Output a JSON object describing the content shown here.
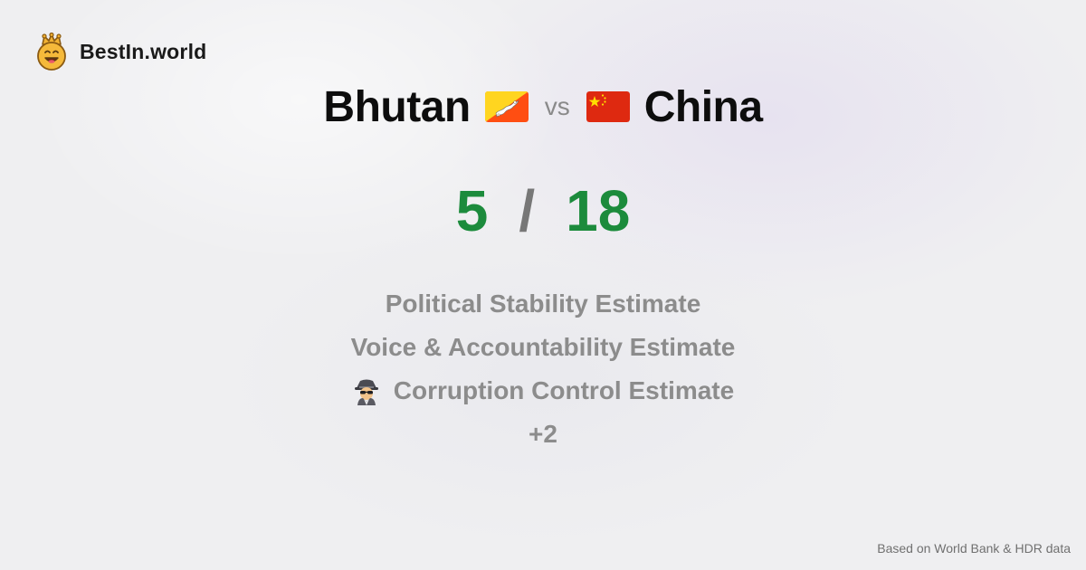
{
  "brand": {
    "logo_icon": "crown-smiley-icon",
    "name": "BestIn.world"
  },
  "comparison": {
    "left_country": "Bhutan",
    "left_flag_icon": "bhutan-flag-icon",
    "vs_label": "vs",
    "right_country": "China",
    "right_flag_icon": "china-flag-icon"
  },
  "scores": {
    "left": "5",
    "separator": "/",
    "right": "18",
    "color": "#1c8b3c"
  },
  "metrics": [
    {
      "label": "Political Stability Estimate"
    },
    {
      "label": "Voice & Accountability Estimate"
    },
    {
      "label": "Corruption Control Estimate",
      "icon": "detective-icon"
    },
    {
      "label": "+2"
    }
  ],
  "footer": {
    "note": "Based on World Bank & HDR data"
  }
}
